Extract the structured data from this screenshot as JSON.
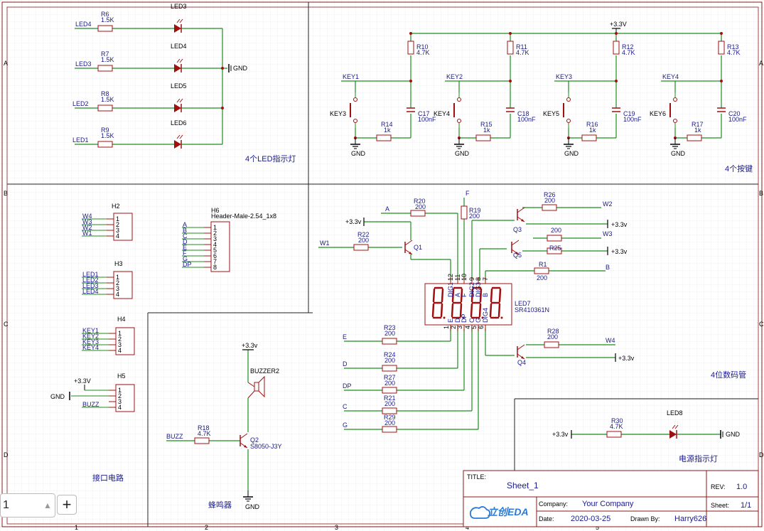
{
  "sections": {
    "led": "4个LED指示灯",
    "keys": "4个按键",
    "iface": "接口电路",
    "buzzer": "蜂鸣器",
    "seg": "4位数码管",
    "power": "电源指示灯"
  },
  "led_block": {
    "rows": [
      {
        "net": "LED4",
        "r": "R6",
        "rv": "1.5K",
        "d": "LED3"
      },
      {
        "net": "LED3",
        "r": "R7",
        "rv": "1.5K",
        "d": "LED4"
      },
      {
        "net": "LED2",
        "r": "R8",
        "rv": "1.5K",
        "d": "LED5"
      },
      {
        "net": "LED1",
        "r": "R9",
        "rv": "1.5K",
        "d": "LED6"
      }
    ],
    "gnd": "GND"
  },
  "key_block": {
    "vcc": "+3.3V",
    "cells": [
      {
        "net": "KEY1",
        "r": "R10",
        "rv": "4.7K",
        "sw": "KEY3",
        "r2": "R14",
        "r2v": "1k",
        "c": "C17",
        "cv": "100nF",
        "gnd": "GND"
      },
      {
        "net": "KEY2",
        "r": "R11",
        "rv": "4.7K",
        "sw": "KEY4",
        "r2": "R15",
        "r2v": "1k",
        "c": "C18",
        "cv": "100nF",
        "gnd": "GND"
      },
      {
        "net": "KEY3",
        "r": "R12",
        "rv": "4.7K",
        "sw": "KEY5",
        "r2": "R16",
        "r2v": "1k",
        "c": "C19",
        "cv": "100nF",
        "gnd": "GND"
      },
      {
        "net": "KEY4",
        "r": "R13",
        "rv": "4.7K",
        "sw": "KEY6",
        "r2": "R17",
        "r2v": "1k",
        "c": "C20",
        "cv": "100nF",
        "gnd": "GND"
      }
    ]
  },
  "headers": {
    "h2": {
      "name": "H2",
      "nets": [
        "W4",
        "W3",
        "W2",
        "W1"
      ],
      "pins": [
        "1",
        "2",
        "3",
        "4"
      ]
    },
    "h3": {
      "name": "H3",
      "nets": [
        "LED1",
        "LED2",
        "LED3",
        "LED4"
      ],
      "pins": [
        "1",
        "2",
        "3",
        "4"
      ]
    },
    "h4": {
      "name": "H4",
      "nets": [
        "KEY1",
        "KEY2",
        "KEY3",
        "KEY4"
      ],
      "pins": [
        "1",
        "2",
        "3",
        "4"
      ]
    },
    "h5": {
      "name": "H5",
      "nets": [
        "+3.3V",
        "GND",
        "BUZZ"
      ],
      "pins": [
        "1",
        "2",
        "3",
        "4"
      ]
    },
    "h6": {
      "name": "H6",
      "part": "Header-Male-2.54_1x8",
      "nets": [
        "A",
        "B",
        "C",
        "D",
        "E",
        "F",
        "G",
        "DP"
      ],
      "pins": [
        "1",
        "2",
        "3",
        "4",
        "5",
        "6",
        "7",
        "8"
      ]
    }
  },
  "buzzer": {
    "vcc": "+3.3v",
    "part": "BUZZER2",
    "net": "BUZZ",
    "r": "R18",
    "rv": "4.7K",
    "q": "Q2",
    "qp": "S8050-J3Y",
    "gnd": "GND"
  },
  "seg": {
    "part": "LED7",
    "pn": "SR410361N",
    "top_pins": [
      "DIG1",
      "A",
      "F",
      "DIG2",
      "DIG3",
      "B"
    ],
    "top_nums": [
      "12",
      "11",
      "10",
      "9",
      "8",
      "7"
    ],
    "bot_pins": [
      "E",
      "D",
      "DP",
      "C",
      "G",
      "DIG4"
    ],
    "bot_nums": [
      "1",
      "2",
      "3",
      "4",
      "5",
      "6"
    ],
    "vcc": "+3.3v",
    "nets": {
      "A": "A",
      "F": "F",
      "W1": "W1",
      "W2": "W2",
      "W3": "W3",
      "W4": "W4",
      "B": "B",
      "E": "E",
      "D": "D",
      "DP": "DP",
      "C": "C",
      "G": "G"
    },
    "res": [
      {
        "r": "R20",
        "v": "200"
      },
      {
        "r": "R19",
        "v": "200"
      },
      {
        "r": "R22",
        "v": "200"
      },
      {
        "r": "R26",
        "v": "200"
      },
      {
        "r": "",
        "v": "200"
      },
      {
        "r": "R25",
        "v": "200"
      },
      {
        "r": "R1",
        "v": "200"
      },
      {
        "r": "R23",
        "v": "200"
      },
      {
        "r": "R24",
        "v": "200"
      },
      {
        "r": "R27",
        "v": "200"
      },
      {
        "r": "R21",
        "v": "200"
      },
      {
        "r": "R29",
        "v": "200"
      },
      {
        "r": "R28",
        "v": "200"
      }
    ],
    "q": [
      "Q1",
      "Q3",
      "Q5",
      "Q4"
    ]
  },
  "power": {
    "vcc": "+3.3v",
    "r": "R30",
    "rv": "4.7K",
    "d": "LED8",
    "gnd": "GND"
  },
  "titleblock": {
    "title_label": "TITLE:",
    "title": "Sheet_1",
    "rev_label": "REV:",
    "rev": "1.0",
    "company_label": "Company:",
    "company": "Your Company",
    "sheet_label": "Sheet:",
    "sheet": "1/1",
    "date_label": "Date:",
    "date": "2020-03-25",
    "drawn_label": "Drawn By:",
    "drawn": "Harry626",
    "logo": "立创EDA"
  },
  "border": {
    "cols": [
      "1",
      "2",
      "3",
      "4",
      "5"
    ],
    "rows": [
      "A",
      "B",
      "C",
      "D"
    ]
  },
  "zoom": {
    "value": "1"
  },
  "colors": {
    "wire": "#1e8c1e",
    "part": "#a01010",
    "net": "#1a1a8c",
    "grid": "#e8e8e8",
    "frame": "#8b1a1a"
  }
}
